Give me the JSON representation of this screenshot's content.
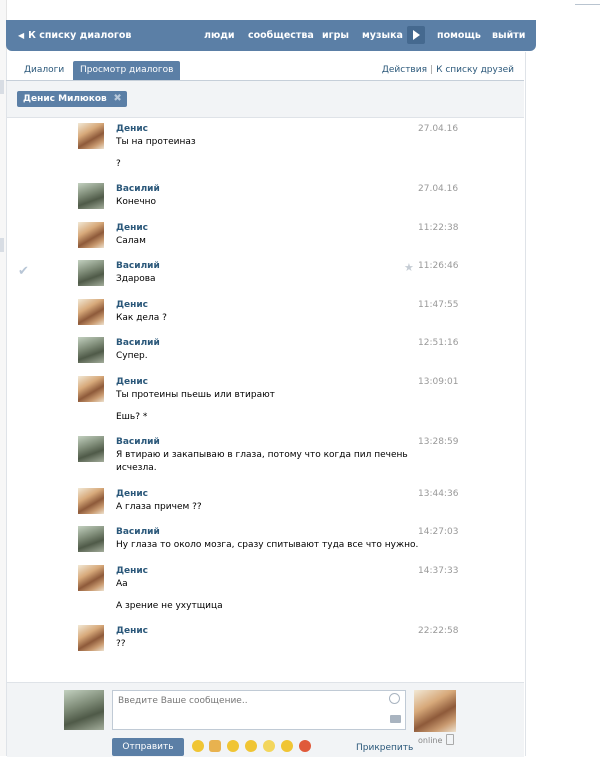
{
  "header": {
    "back_label": "К списку диалогов",
    "nav": [
      "люди",
      "сообщества",
      "игры",
      "музыка",
      "помощь",
      "выйти"
    ]
  },
  "tabs": {
    "dialogs": "Диалоги",
    "view_dialogs": "Просмотр диалогов",
    "actions": "Действия",
    "to_friends": "К списку друзей"
  },
  "filter_chip": "Денис Милюков",
  "messages": [
    {
      "author": "Денис",
      "time": "27.04.16",
      "lines": [
        "Ты на протеиназ",
        "?"
      ]
    },
    {
      "author": "Василий",
      "time": "27.04.16",
      "lines": [
        "Конечно"
      ]
    },
    {
      "author": "Денис",
      "time": "11:22:38",
      "lines": [
        "Салам"
      ]
    },
    {
      "author": "Василий",
      "time": "11:26:46",
      "lines": [
        "Здарова"
      ]
    },
    {
      "author": "Денис",
      "time": "11:47:55",
      "lines": [
        "Как дела ?"
      ]
    },
    {
      "author": "Василий",
      "time": "12:51:16",
      "lines": [
        "Супер."
      ]
    },
    {
      "author": "Денис",
      "time": "13:09:01",
      "lines": [
        "Ты протеины пьешь или втирают",
        "Ешь? *"
      ]
    },
    {
      "author": "Василий",
      "time": "13:28:59",
      "lines": [
        "Я втираю и закапываю в глаза, потому что когда пил печень",
        "исчезла."
      ]
    },
    {
      "author": "Денис",
      "time": "13:44:36",
      "lines": [
        "А глаза причем ??"
      ]
    },
    {
      "author": "Василий",
      "time": "14:27:03",
      "lines": [
        "Ну глаза то около мозга, сразу спитывают туда все что нужно."
      ]
    },
    {
      "author": "Денис",
      "time": "14:37:33",
      "lines": [
        "Аа",
        "А зрение не ухутщица"
      ]
    },
    {
      "author": "Денис",
      "time": "22:22:58",
      "lines": [
        "??"
      ]
    }
  ],
  "composer": {
    "placeholder": "Введите Ваше сообщение..",
    "send_label": "Отправить",
    "attach_label": "Прикрепить",
    "online_label": "online"
  },
  "colors": {
    "accent": "#5b7fa6",
    "link": "#2b587a"
  },
  "icons": [
    "back-arrow-icon",
    "play-icon",
    "close-icon",
    "star-icon",
    "check-icon",
    "smiley-icon",
    "camera-icon",
    "phone-icon"
  ]
}
